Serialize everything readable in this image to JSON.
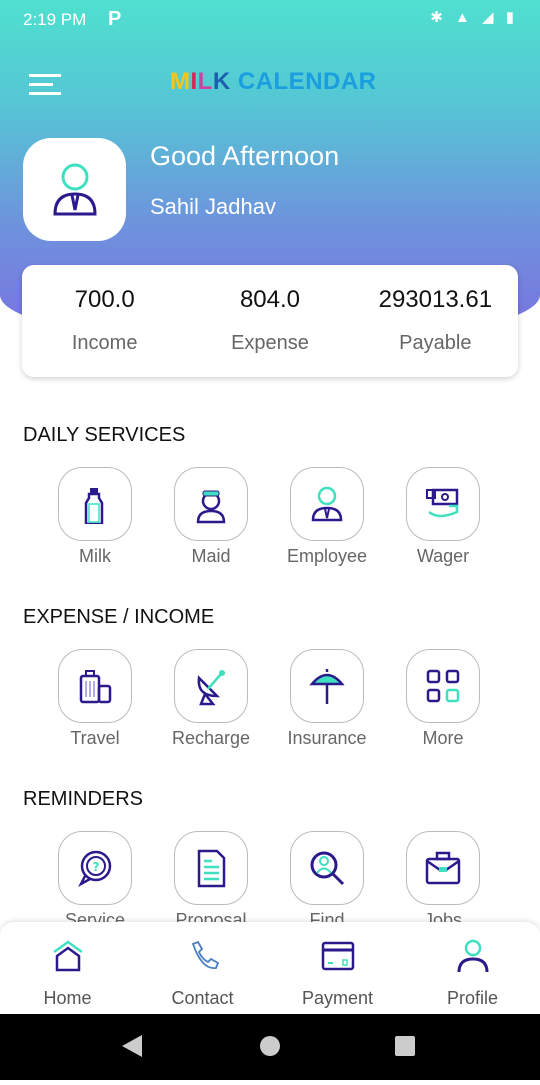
{
  "status_bar": {
    "time": "2:19 PM",
    "app_icon": "P",
    "right_icons": "✱ ▲ ◢ ▮"
  },
  "header": {
    "logo": {
      "m": "M",
      "i": "I",
      "l": "L",
      "k": "K",
      "rest": " CALENDAR"
    },
    "greeting": "Good Afternoon",
    "user_name": "Sahil Jadhav"
  },
  "stats": [
    {
      "value": "700.0",
      "label": "Income"
    },
    {
      "value": "804.0",
      "label": "Expense"
    },
    {
      "value": "293013.61",
      "label": "Payable"
    }
  ],
  "sections": [
    {
      "title": "DAILY SERVICES",
      "items": [
        {
          "label": "Milk",
          "icon": "milk-bottle"
        },
        {
          "label": "Maid",
          "icon": "maid"
        },
        {
          "label": "Employee",
          "icon": "employee"
        },
        {
          "label": "Wager",
          "icon": "wage-money"
        }
      ]
    },
    {
      "title": "EXPENSE / INCOME",
      "items": [
        {
          "label": "Travel",
          "icon": "luggage"
        },
        {
          "label": "Recharge",
          "icon": "satellite-dish"
        },
        {
          "label": "Insurance",
          "icon": "umbrella"
        },
        {
          "label": "More",
          "icon": "grid"
        }
      ]
    },
    {
      "title": "REMINDERS",
      "items": [
        {
          "label": "Service",
          "icon": "question-bubble"
        },
        {
          "label": "Proposal",
          "icon": "document"
        },
        {
          "label": "Find",
          "icon": "search-person"
        },
        {
          "label": "Jobs",
          "icon": "briefcase"
        }
      ]
    }
  ],
  "bottom_nav": [
    {
      "label": "Home",
      "icon": "home"
    },
    {
      "label": "Contact",
      "icon": "phone"
    },
    {
      "label": "Payment",
      "icon": "card"
    },
    {
      "label": "Profile",
      "icon": "user"
    }
  ],
  "colors": {
    "primary": "#2a1a8c",
    "accent": "#3fe0c0"
  }
}
